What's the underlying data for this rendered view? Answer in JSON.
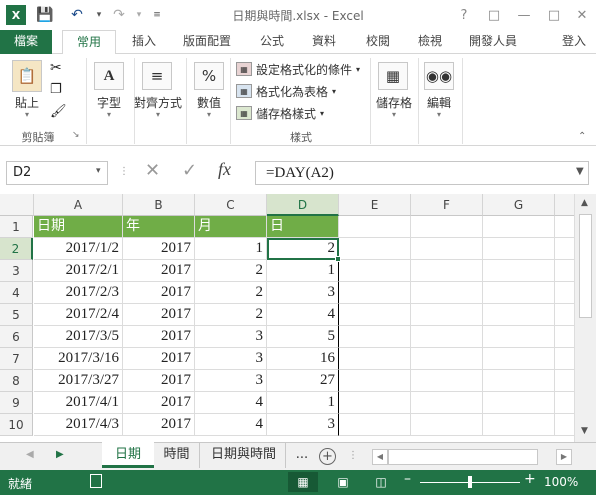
{
  "window": {
    "title": "日期與時間.xlsx - Excel",
    "help": "?",
    "controls": [
      "—",
      "□",
      "✕"
    ]
  },
  "tabs": {
    "file": "檔案",
    "items": [
      "常用",
      "插入",
      "版面配置",
      "公式",
      "資料",
      "校閱",
      "檢視",
      "開發人員"
    ],
    "active": "常用",
    "signin": "登入"
  },
  "ribbon": {
    "clipboard": {
      "paste": "貼上",
      "group": "剪貼簿"
    },
    "font": {
      "label": "字型"
    },
    "alignment": {
      "label": "對齊方式"
    },
    "number": {
      "label": "數值"
    },
    "styles": {
      "conditional": "設定格式化的條件",
      "format_table": "格式化為表格",
      "cell_styles": "儲存格樣式",
      "group": "樣式"
    },
    "cells": {
      "label": "儲存格"
    },
    "editing": {
      "label": "編輯"
    }
  },
  "formula_bar": {
    "name_box": "D2",
    "fx": "fx",
    "formula": "=DAY(A2)"
  },
  "sheet": {
    "columns": [
      "A",
      "B",
      "C",
      "D",
      "E",
      "F",
      "G"
    ],
    "rows": [
      "1",
      "2",
      "3",
      "4",
      "5",
      "6",
      "7",
      "8",
      "9",
      "10"
    ],
    "header": [
      "日期",
      "年",
      "月",
      "日"
    ],
    "data": [
      [
        "2017/1/2",
        "2017",
        "1",
        "2"
      ],
      [
        "2017/2/1",
        "2017",
        "2",
        "1"
      ],
      [
        "2017/2/3",
        "2017",
        "2",
        "3"
      ],
      [
        "2017/2/4",
        "2017",
        "2",
        "4"
      ],
      [
        "2017/3/5",
        "2017",
        "3",
        "5"
      ],
      [
        "2017/3/16",
        "2017",
        "3",
        "16"
      ],
      [
        "2017/3/27",
        "2017",
        "3",
        "27"
      ],
      [
        "2017/4/1",
        "2017",
        "4",
        "1"
      ],
      [
        "2017/4/3",
        "2017",
        "4",
        "3"
      ]
    ],
    "selected_cell": "D2",
    "header_fill": "#70ad47"
  },
  "sheet_tabs": {
    "items": [
      "日期",
      "時間",
      "日期與時間"
    ],
    "active": "日期",
    "more": "...",
    "add": "+"
  },
  "status": {
    "ready": "就緒",
    "zoom": "100%"
  },
  "colors": {
    "accent": "#217346"
  }
}
